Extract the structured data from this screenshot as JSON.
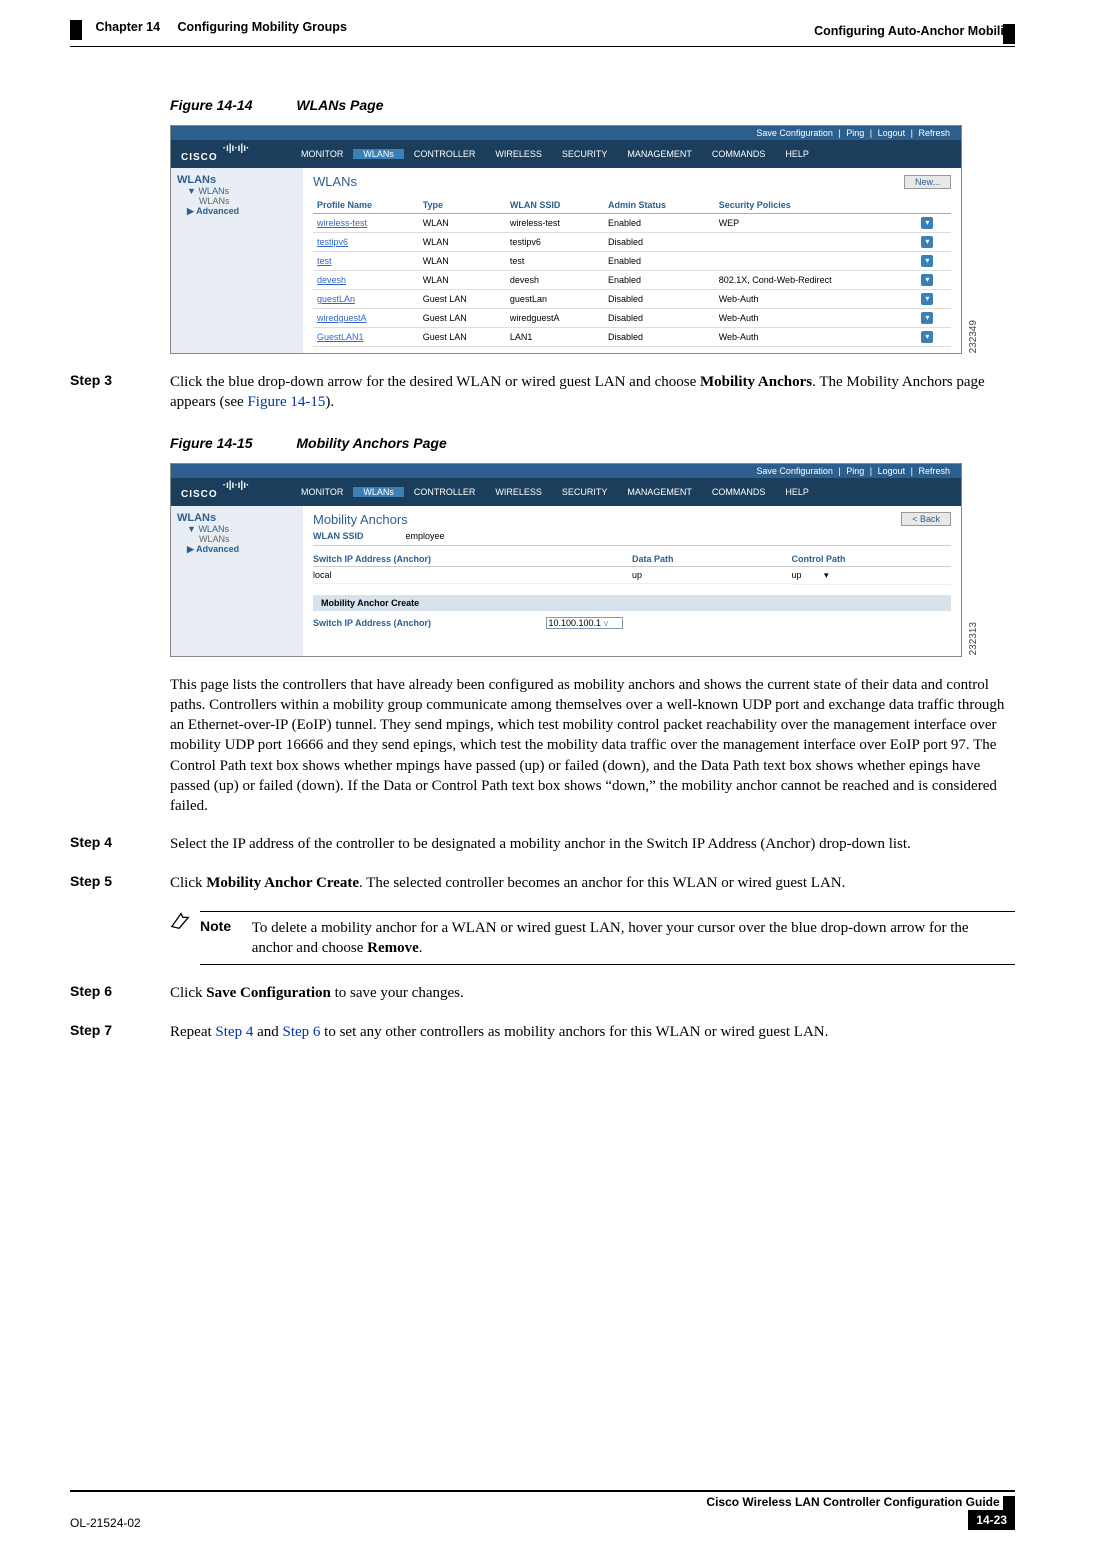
{
  "header": {
    "chapter": "Chapter 14",
    "chapter_title": "Configuring Mobility Groups",
    "section": "Configuring Auto-Anchor Mobility"
  },
  "fig14": {
    "num": "Figure 14-14",
    "title": "WLANs Page",
    "shot_id": "232349"
  },
  "fig15": {
    "num": "Figure 14-15",
    "title": "Mobility Anchors Page",
    "shot_id": "232313"
  },
  "topbar": {
    "save": "Save Configuration",
    "ping": "Ping",
    "logout": "Logout",
    "refresh": "Refresh"
  },
  "brand": "CISCO",
  "menu": {
    "monitor": "MONITOR",
    "wlans": "WLANs",
    "controller": "CONTROLLER",
    "wireless": "WIRELESS",
    "security": "SECURITY",
    "management": "MANAGEMENT",
    "commands": "COMMANDS",
    "help": "HELP"
  },
  "sidenav": {
    "hd": "WLANs",
    "item1": "WLANs",
    "sub1": "WLANs",
    "item2": "Advanced"
  },
  "wlans": {
    "title": "WLANs",
    "new_btn": "New...",
    "cols": {
      "profile": "Profile Name",
      "type": "Type",
      "ssid": "WLAN SSID",
      "admin": "Admin Status",
      "sec": "Security Policies"
    },
    "rows": [
      {
        "p": "wireless-test",
        "t": "WLAN",
        "s": "wireless-test",
        "a": "Enabled",
        "sp": "WEP"
      },
      {
        "p": "testipv6",
        "t": "WLAN",
        "s": "testipv6",
        "a": "Disabled",
        "sp": ""
      },
      {
        "p": "test",
        "t": "WLAN",
        "s": "test",
        "a": "Enabled",
        "sp": ""
      },
      {
        "p": "devesh",
        "t": "WLAN",
        "s": "devesh",
        "a": "Enabled",
        "sp": "802.1X, Cond-Web-Redirect"
      },
      {
        "p": "guestLAn",
        "t": "Guest LAN",
        "s": "guestLan",
        "a": "Disabled",
        "sp": "Web-Auth"
      },
      {
        "p": "wiredguestA",
        "t": "Guest LAN",
        "s": "wiredguestA",
        "a": "Disabled",
        "sp": "Web-Auth"
      },
      {
        "p": "GuestLAN1",
        "t": "Guest LAN",
        "s": "LAN1",
        "a": "Disabled",
        "sp": "Web-Auth"
      }
    ]
  },
  "anchors": {
    "title": "Mobility Anchors",
    "back_btn": "< Back",
    "ssid_lbl": "WLAN SSID",
    "ssid_val": "employee",
    "col_switch": "Switch IP Address (Anchor)",
    "col_data": "Data Path",
    "col_ctrl": "Control Path",
    "row_switch": "local",
    "row_data": "up",
    "row_ctrl": "up",
    "create_bar": "Mobility Anchor Create",
    "create_lbl": "Switch IP Address (Anchor)",
    "create_val": "10.100.100.1"
  },
  "steps": {
    "s3_lbl": "Step 3",
    "s3_a": "Click the blue drop-down arrow for the desired WLAN or wired guest LAN and choose ",
    "s3_b": "Mobility Anchors",
    "s3_c": ". The Mobility Anchors page appears (see ",
    "s3_link": "Figure 14-15",
    "s3_d": ").",
    "s4_lbl": "Step 4",
    "s4": "Select the IP address of the controller to be designated a mobility anchor in the Switch IP Address (Anchor) drop-down list.",
    "s5_lbl": "Step 5",
    "s5_a": "Click ",
    "s5_b": "Mobility Anchor Create",
    "s5_c": ". The selected controller becomes an anchor for this WLAN or wired guest LAN.",
    "s6_lbl": "Step 6",
    "s6_a": "Click ",
    "s6_b": "Save Configuration",
    "s6_c": " to save your changes.",
    "s7_lbl": "Step 7",
    "s7_a": "Repeat ",
    "s7_l1": "Step 4",
    "s7_b": " and ",
    "s7_l2": "Step 6",
    "s7_c": " to set any other controllers as mobility anchors for this WLAN or wired guest LAN."
  },
  "para1": "This page lists the controllers that have already been configured as mobility anchors and shows the current state of their data and control paths. Controllers within a mobility group communicate among themselves over a well-known UDP port and exchange data traffic through an Ethernet-over-IP (EoIP) tunnel. They send mpings, which test mobility control packet reachability over the management interface over mobility UDP port 16666 and they send epings, which test the mobility data traffic over the management interface over EoIP port 97. The Control Path text box shows whether mpings have passed (up) or failed (down), and the Data Path text box shows whether epings have passed (up) or failed (down). If the Data or Control Path text box shows “down,” the mobility anchor cannot be reached and is considered failed.",
  "note": {
    "lbl": "Note",
    "txt_a": "To delete a mobility anchor for a WLAN or wired guest LAN, hover your cursor over the blue drop-down arrow for the anchor and choose ",
    "txt_b": "Remove",
    "txt_c": "."
  },
  "footer": {
    "doc_title": "Cisco Wireless LAN Controller Configuration Guide",
    "doc_id": "OL-21524-02",
    "page": "14-23"
  }
}
